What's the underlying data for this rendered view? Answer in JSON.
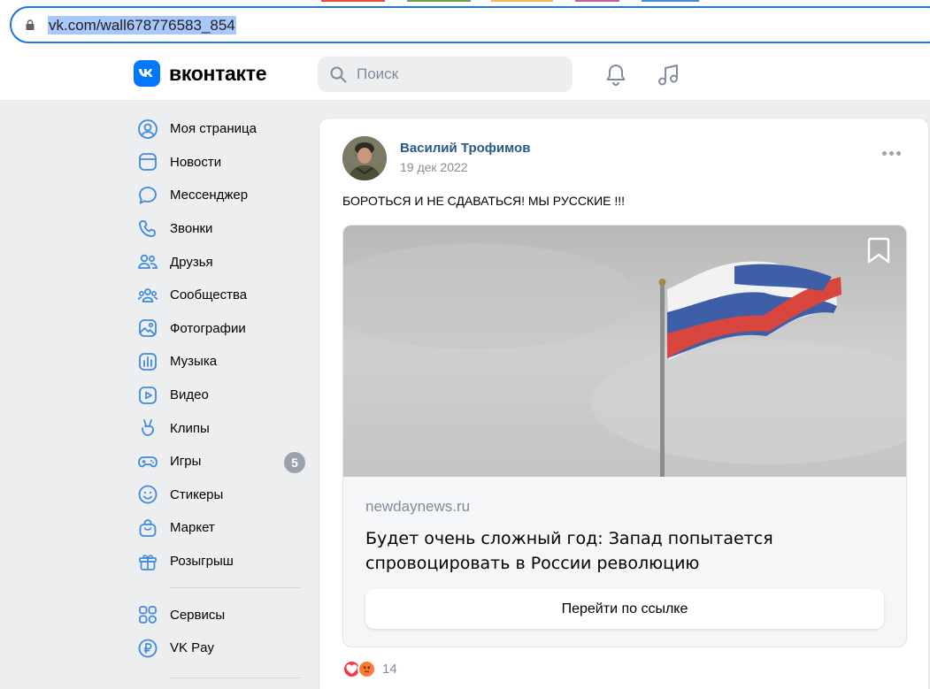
{
  "browser": {
    "url": "vk.com/wall678776583_854"
  },
  "header": {
    "logo_text": "вконтакте",
    "search_placeholder": "Поиск"
  },
  "nav": {
    "items": [
      {
        "label": "Моя страница",
        "icon": "user-circle-icon"
      },
      {
        "label": "Новости",
        "icon": "news-icon"
      },
      {
        "label": "Мессенджер",
        "icon": "message-icon"
      },
      {
        "label": "Звонки",
        "icon": "phone-icon"
      },
      {
        "label": "Друзья",
        "icon": "friends-icon"
      },
      {
        "label": "Сообщества",
        "icon": "communities-icon"
      },
      {
        "label": "Фотографии",
        "icon": "photo-icon"
      },
      {
        "label": "Музыка",
        "icon": "music-icon"
      },
      {
        "label": "Видео",
        "icon": "video-icon"
      },
      {
        "label": "Клипы",
        "icon": "clips-icon"
      },
      {
        "label": "Игры",
        "icon": "gamepad-icon",
        "badge": "5"
      },
      {
        "label": "Стикеры",
        "icon": "smile-icon"
      },
      {
        "label": "Маркет",
        "icon": "bag-icon"
      },
      {
        "label": "Розыгрыш",
        "icon": "gift-icon"
      }
    ],
    "secondary": [
      {
        "label": "Сервисы",
        "icon": "services-icon"
      },
      {
        "label": "VK Pay",
        "icon": "ruble-icon"
      }
    ]
  },
  "post": {
    "author": "Василий Трофимов",
    "date": "19 дек 2022",
    "text": "БОРОТЬСЯ И НЕ СДАВАТЬСЯ! МЫ РУССКИЕ !!!",
    "link": {
      "domain": "newdaynews.ru",
      "title": "Будет очень сложный год: Запад попытается спровоцировать в России революцию",
      "button": "Перейти по ссылке"
    },
    "reactions_count": "14"
  },
  "colors": {
    "vk_blue": "#0077ff",
    "author_link": "#2a5885",
    "secondary_text": "#818c99",
    "page_bg": "#edeef0"
  }
}
